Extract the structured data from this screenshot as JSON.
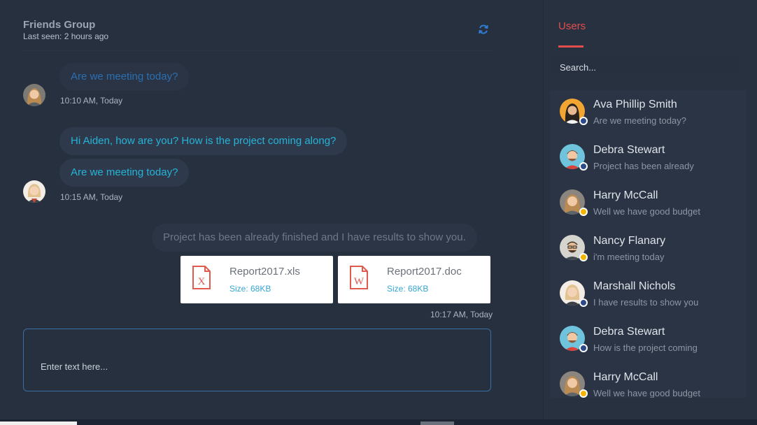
{
  "chat": {
    "title": "Friends Group",
    "last_seen": "Last seen: 2 hours ago",
    "messages": [
      {
        "text": "Are we meeting today?"
      },
      {
        "text": "Hi Aiden, how are you? How is the project coming along?"
      },
      {
        "text": "Are we meeting today?"
      },
      {
        "text": "Project has been already finished and I have results to show you."
      }
    ],
    "times": [
      "10:10 AM, Today",
      "10:15 AM, Today",
      "10:17 AM, Today"
    ],
    "files": [
      {
        "name": "Report2017.xls",
        "size": "Size: 68KB",
        "icon": "excel-file-icon",
        "letter": "X"
      },
      {
        "name": "Report2017.doc",
        "size": "Size: 68KB",
        "icon": "word-file-icon",
        "letter": "W"
      }
    ],
    "composer_placeholder": "Enter text here..."
  },
  "sidebar": {
    "tab": "Users",
    "search_placeholder": "Search...",
    "users": [
      {
        "name": "Ava Phillip Smith",
        "message": "Are we meeting today?",
        "status": "online"
      },
      {
        "name": "Debra Stewart",
        "message": "Project has been already",
        "status": "online"
      },
      {
        "name": "Harry McCall",
        "message": "Well we have good budget",
        "status": "away"
      },
      {
        "name": "Nancy Flanary",
        "message": "i'm meeting today",
        "status": "away"
      },
      {
        "name": "Marshall Nichols",
        "message": "I have results to show you",
        "status": "online"
      },
      {
        "name": "Debra Stewart",
        "message": "How is the project coming",
        "status": "online"
      },
      {
        "name": "Harry McCall",
        "message": "Well we have good budget",
        "status": "away"
      }
    ]
  },
  "colors": {
    "accent": "#e34d4d",
    "teal_text": "#25b4d8",
    "online": "#2b4a8a",
    "away": "#f5b400"
  }
}
